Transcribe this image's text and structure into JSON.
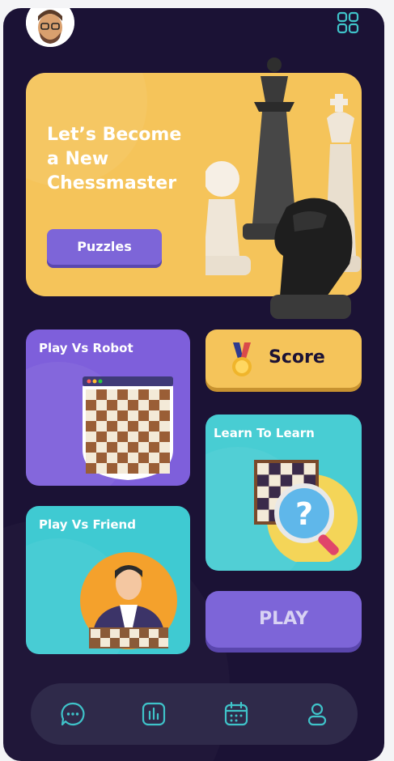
{
  "header": {
    "avatar_icon": "user-avatar",
    "grid_icon": "grid-icon"
  },
  "hero": {
    "title": "Let’s Become\na New\nChessmaster",
    "button_label": "Puzzles"
  },
  "cards": {
    "robot": {
      "title": "Play Vs Robot"
    },
    "score": {
      "label": "Score",
      "icon": "medal-icon"
    },
    "learn": {
      "title": "Learn To Learn"
    },
    "friend": {
      "title": "Play Vs Friend"
    },
    "play": {
      "label": "PLAY"
    }
  },
  "bottom_nav": [
    {
      "icon": "chat-icon"
    },
    {
      "icon": "stats-icon"
    },
    {
      "icon": "calendar-icon"
    },
    {
      "icon": "profile-icon"
    }
  ],
  "colors": {
    "background": "#1b1235",
    "yellow": "#f5c45a",
    "purple": "#7d65d8",
    "teal": "#48cdd3",
    "nav_icon": "#3fc3c9"
  }
}
